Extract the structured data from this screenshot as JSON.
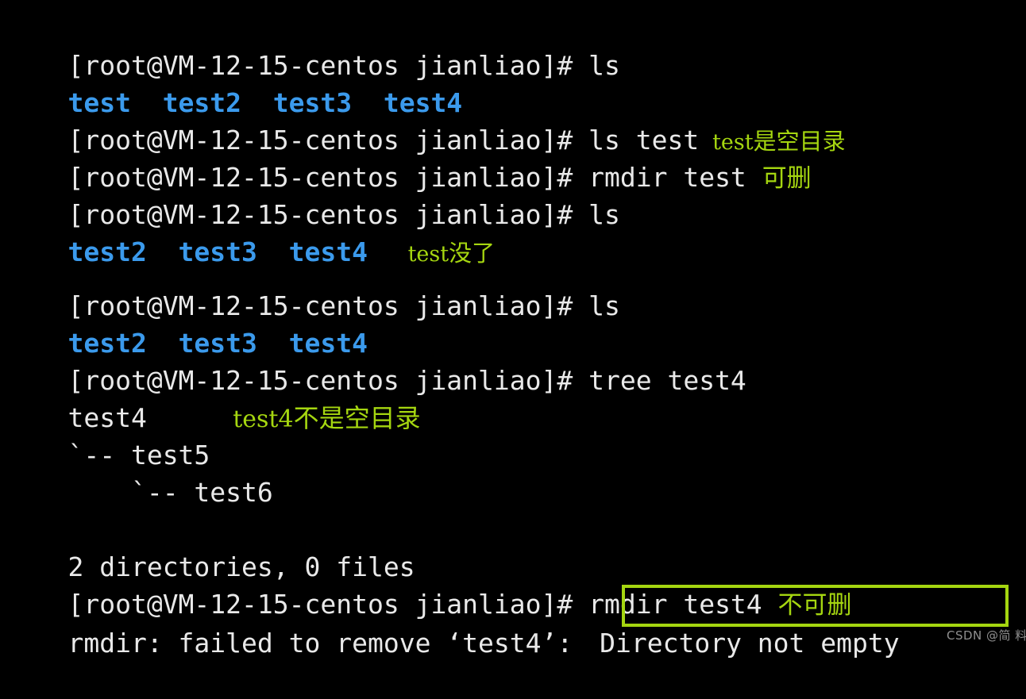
{
  "terminal": {
    "prompt": "[root@VM-12-15-centos jianliao]# ",
    "background_color": "#000000",
    "text_color": "#e9e9e9",
    "dir_color": "#3b9aec",
    "annotation_color": "#a5d610",
    "lines": [
      {
        "id": "line-1",
        "type": "command",
        "prompt": "[root@VM-12-15-centos jianliao]# ",
        "command": "ls"
      },
      {
        "id": "line-2",
        "type": "output-dirs",
        "text": "test  test2  test3  test4"
      },
      {
        "id": "line-3",
        "type": "command",
        "prompt": "[root@VM-12-15-centos jianliao]# ",
        "command": "ls test",
        "annotation": "test是空目录",
        "annotation_latin": "test",
        "annotation_han": "是空目录"
      },
      {
        "id": "line-4",
        "type": "command",
        "prompt": "[root@VM-12-15-centos jianliao]# ",
        "command": "rmdir test",
        "annotation": "可删"
      },
      {
        "id": "line-5",
        "type": "command",
        "prompt": "[root@VM-12-15-centos jianliao]# ",
        "command": "ls"
      },
      {
        "id": "line-6",
        "type": "output-dirs",
        "text": "test2  test3  test4",
        "annotation_latin": "test",
        "annotation_han": "没了"
      },
      {
        "id": "line-7",
        "type": "blank",
        "text": ""
      },
      {
        "id": "line-8",
        "type": "command",
        "prompt": "[root@VM-12-15-centos jianliao]# ",
        "command": "ls"
      },
      {
        "id": "line-9",
        "type": "output-dirs",
        "text": "test2  test3  test4"
      },
      {
        "id": "line-10",
        "type": "command",
        "prompt": "[root@VM-12-15-centos jianliao]# ",
        "command": "tree test4"
      },
      {
        "id": "line-11",
        "type": "output",
        "text": "test4",
        "annotation_latin": "test4",
        "annotation_han": "不是空目录"
      },
      {
        "id": "line-12",
        "type": "output",
        "text": "`-- test5"
      },
      {
        "id": "line-13",
        "type": "output",
        "text": "    `-- test6"
      },
      {
        "id": "line-14",
        "type": "blank",
        "text": ""
      },
      {
        "id": "line-15",
        "type": "output",
        "text": "2 directories, 0 files"
      },
      {
        "id": "line-16",
        "type": "command",
        "prompt": "[root@VM-12-15-centos jianliao]# ",
        "command": "rmdir test4",
        "annotation": "不可删"
      },
      {
        "id": "line-17",
        "type": "error",
        "prefix": "rmdir: failed to remove ‘test4’: ",
        "highlighted": "Directory not empty"
      }
    ]
  },
  "watermark": {
    "text": "CSDN @简 料"
  }
}
